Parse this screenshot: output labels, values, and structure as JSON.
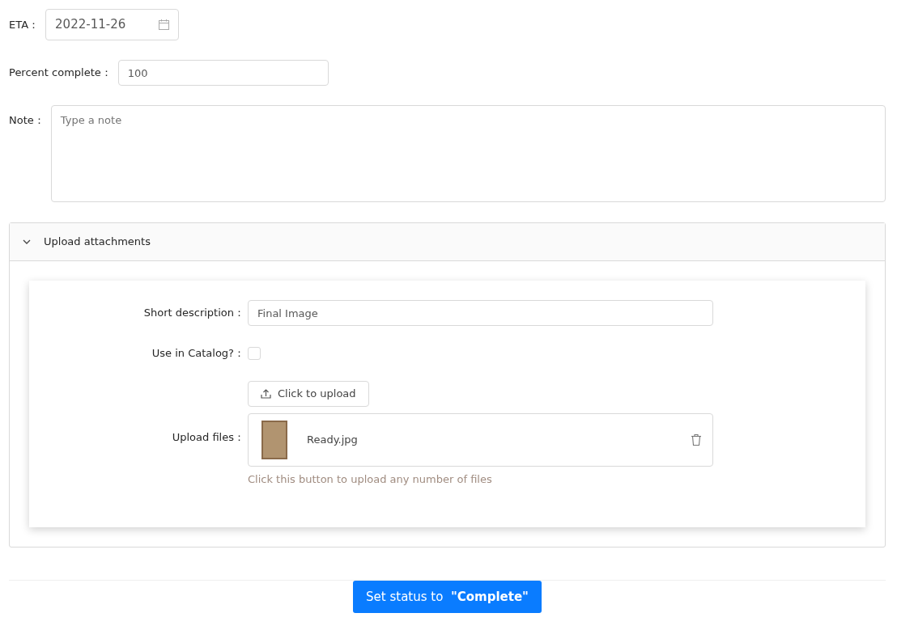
{
  "eta": {
    "label": "ETA：",
    "value": "2022-11-26"
  },
  "percent": {
    "label": "Percent complete：",
    "value": "100"
  },
  "note": {
    "label": "Note：",
    "placeholder": "Type a note"
  },
  "attachments": {
    "title": "Upload attachments",
    "expanded": true,
    "short_description": {
      "label": "Short description：",
      "value": "Final Image"
    },
    "catalog": {
      "label": "Use in Catalog?：",
      "checked": false
    },
    "upload": {
      "label": "Upload files：",
      "button": "Click to upload",
      "files": [
        {
          "name": "Ready.jpg"
        }
      ],
      "help": "Click this button to upload any number of files"
    }
  },
  "submit": "Set status to  **\"Complete\"**"
}
